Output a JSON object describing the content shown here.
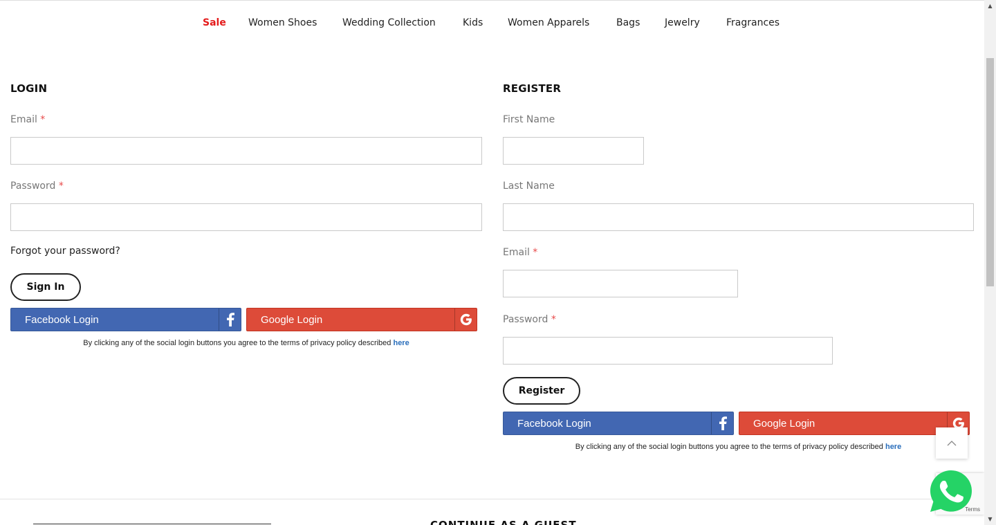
{
  "nav": {
    "items": [
      {
        "label": "Sale"
      },
      {
        "label": "Women Shoes"
      },
      {
        "label": "Wedding Collection"
      },
      {
        "label": "Kids"
      },
      {
        "label": "Women Apparels"
      },
      {
        "label": "Bags"
      },
      {
        "label": "Jewelry"
      },
      {
        "label": "Fragrances"
      }
    ]
  },
  "login": {
    "title": "LOGIN",
    "email_label": "Email",
    "password_label": "Password",
    "required_mark": "*",
    "forgot": "Forgot your password?",
    "sign_in": "Sign In",
    "facebook": "Facebook Login",
    "google": "Google Login",
    "note": "By clicking any of the social login buttons you agree to the terms of privacy policy described",
    "note_link": "here"
  },
  "register": {
    "title": "REGISTER",
    "first_name_label": "First Name",
    "last_name_label": "Last Name",
    "email_label": "Email",
    "password_label": "Password",
    "required_mark": "*",
    "register_btn": "Register",
    "facebook": "Facebook Login",
    "google": "Google Login",
    "note": "By clicking any of the social login buttons you agree to the terms of privacy policy described",
    "note_link": "here"
  },
  "guest": {
    "title": "CONTINUE AS A GUEST"
  },
  "recaptcha": {
    "terms": "Terms"
  },
  "colors": {
    "sale": "#e41b1b",
    "facebook": "#4267b2",
    "google": "#dd4b39",
    "whatsapp": "#25d366",
    "required": "#e84a4a"
  }
}
